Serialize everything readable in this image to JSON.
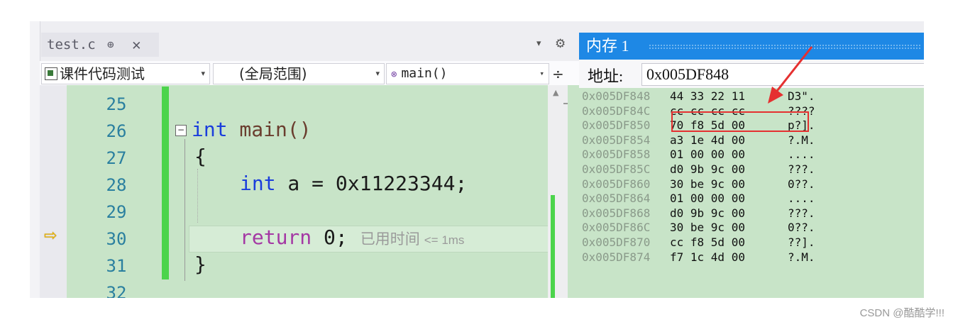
{
  "editor": {
    "tab": {
      "filename": "test.c",
      "pin": "⊕",
      "close": "✕"
    },
    "nav": {
      "project": "课件代码测试",
      "scope": "(全局范围)",
      "function": "main()",
      "split_glyph": "÷"
    },
    "lines": [
      {
        "no": "25",
        "code": ""
      },
      {
        "no": "26",
        "kw": "int",
        "rest": " main()"
      },
      {
        "no": "27",
        "code": "{"
      },
      {
        "no": "28",
        "kw": "int",
        "rest": " a = 0x11223344;"
      },
      {
        "no": "29",
        "code": ""
      },
      {
        "no": "30",
        "ret": "return",
        "rest": " 0;",
        "elapsed": "已用时间",
        "elapsed_time": "<= 1ms"
      },
      {
        "no": "31",
        "code": "}"
      },
      {
        "no": "32",
        "code": ""
      }
    ],
    "collapse_glyph": "−"
  },
  "memory": {
    "title": "内存 1",
    "address_label": "地址:",
    "address_value": "0x005DF848",
    "rows": [
      {
        "addr": "0x005DF848",
        "bytes": "44 33 22 11",
        "ascii": "D3\"."
      },
      {
        "addr": "0x005DF84C",
        "bytes": "cc cc cc cc",
        "ascii": "????"
      },
      {
        "addr": "0x005DF850",
        "bytes": "70 f8 5d 00",
        "ascii": "p?]."
      },
      {
        "addr": "0x005DF854",
        "bytes": "a3 1e 4d 00",
        "ascii": "?.M."
      },
      {
        "addr": "0x005DF858",
        "bytes": "01 00 00 00",
        "ascii": "...."
      },
      {
        "addr": "0x005DF85C",
        "bytes": "d0 9b 9c 00",
        "ascii": "???."
      },
      {
        "addr": "0x005DF860",
        "bytes": "30 be 9c 00",
        "ascii": "0??."
      },
      {
        "addr": "0x005DF864",
        "bytes": "01 00 00 00",
        "ascii": "...."
      },
      {
        "addr": "0x005DF868",
        "bytes": "d0 9b 9c 00",
        "ascii": "???."
      },
      {
        "addr": "0x005DF86C",
        "bytes": "30 be 9c 00",
        "ascii": "0??."
      },
      {
        "addr": "0x005DF870",
        "bytes": "cc f8 5d 00",
        "ascii": "??]."
      },
      {
        "addr": "0x005DF874",
        "bytes": "f7 1c 4d 00",
        "ascii": "?.M."
      }
    ]
  },
  "annotation": {
    "arrow_color": "#e53030",
    "box_color": "#e53030"
  },
  "watermark": "CSDN @酷酷学!!!",
  "colors": {
    "editor_bg": "#c8e4c8",
    "changed_bar": "#4cd44c",
    "memory_title_bg": "#1e88e5",
    "keyword": "#1a3ddc",
    "return_keyword": "#a438a4"
  }
}
